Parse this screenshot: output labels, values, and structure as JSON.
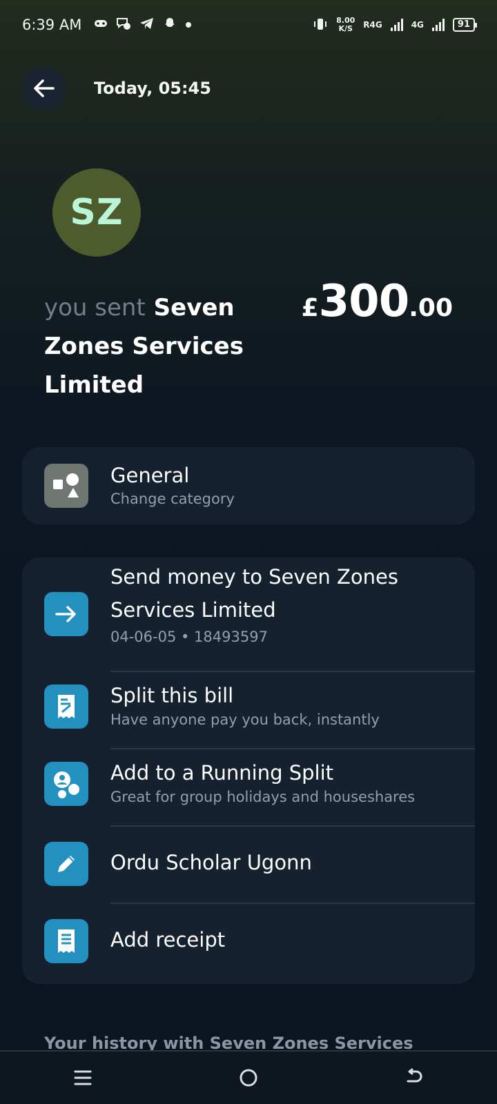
{
  "status_bar": {
    "time": "6:39 AM",
    "net_speed_value": "8.00",
    "net_speed_unit": "K/S",
    "sim1_label": "R4G",
    "sim2_label": "4G",
    "battery": "91"
  },
  "header": {
    "title": "Today, 05:45"
  },
  "avatar": {
    "initials": "SZ"
  },
  "transaction": {
    "prefix": "you sent",
    "recipient": "Seven Zones Services Limited",
    "currency_symbol": "£",
    "amount_major": "300",
    "amount_minor": ".00"
  },
  "category": {
    "title": "General",
    "subtitle": "Change category"
  },
  "actions": [
    {
      "title": "Send money to Seven Zones Services Limited",
      "subtitle": "04-06-05 • 18493597"
    },
    {
      "title": "Split this bill",
      "subtitle": "Have anyone pay you back, instantly"
    },
    {
      "title": "Add to a Running Split",
      "subtitle": "Great for group holidays and houseshares"
    },
    {
      "title": "Ordu Scholar Ugonn"
    },
    {
      "title": "Add receipt"
    }
  ],
  "history": {
    "title": "Your history with Seven Zones Services"
  },
  "colors": {
    "accent_blue": "#2490c0",
    "card_bg": "#15212e",
    "avatar_bg": "#4e5b2c",
    "avatar_text": "#b9f5d8"
  }
}
